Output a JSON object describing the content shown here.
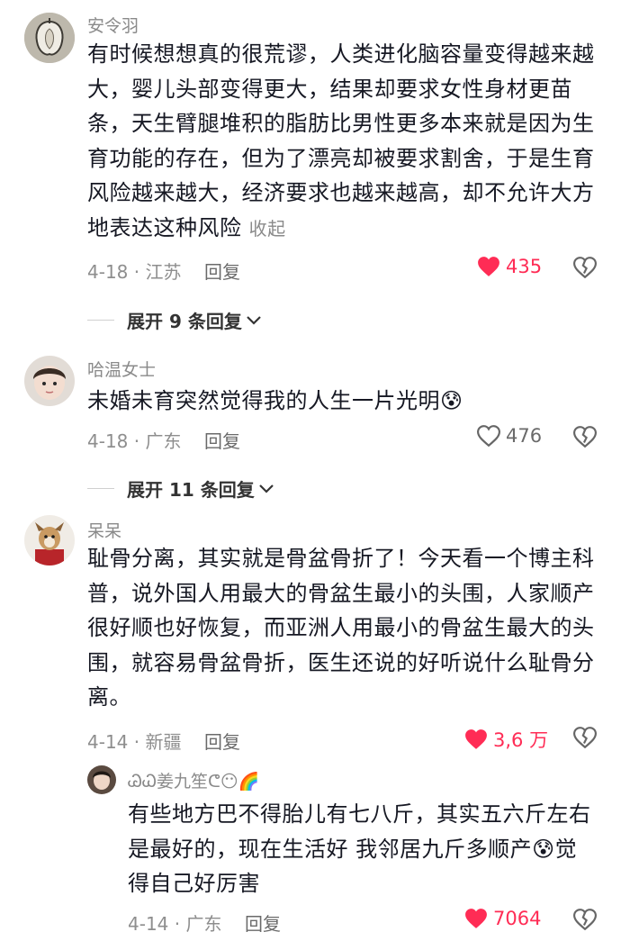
{
  "colors": {
    "like_active": "#ff2c55",
    "text": "#161823",
    "muted": "#8a8a8a"
  },
  "comments": [
    {
      "username": "安令羽",
      "text": "有时候想想真的很荒谬，人类进化脑容量变得越来越大，婴儿头部变得更大，结果却要求女性身材更苗条，天生臂腿堆积的脂肪比男性更多本来就是因为生育功能的存在，但为了漂亮却被要求割舍，于是生育风险越来越大，经济要求也越来越高，却不允许大方地表达这种风险",
      "collapse": "收起",
      "meta": "4-18 · 江苏",
      "reply": "回复",
      "likes": "435",
      "liked": true,
      "expand": "展开 9 条回复"
    },
    {
      "username": "哈温女士",
      "text": "未婚未育突然觉得我的人生一片光明",
      "emoji": "😰",
      "meta": "4-18 · 广东",
      "reply": "回复",
      "likes": "476",
      "liked": false,
      "expand": "展开 11 条回复"
    },
    {
      "username": "呆呆",
      "text": "耻骨分离，其实就是骨盆骨折了！今天看一个博主科普，说外国人用最大的骨盆生最小的头围，人家顺产很好顺也好恢复，而亚洲人用最小的骨盆生最大的头围，就容易骨盆骨折，医生还说的好听说什么耻骨分离。",
      "meta": "4-14 · 新疆",
      "reply": "回复",
      "likes": "3,6 万",
      "liked": true
    }
  ],
  "subreply": {
    "username": "ᏊᏇ姜九笙ᕦ😶",
    "username_emoji": "🌈",
    "text_a": "有些地方巴不得胎儿有七八斤，其实五六斤左右是最好的，现在生活好 我邻居九斤多顺产",
    "emoji": "😰",
    "text_b": "觉得自己好厉害",
    "meta": "4-14 · 广东",
    "reply": "回复",
    "likes": "7064",
    "liked": true
  }
}
